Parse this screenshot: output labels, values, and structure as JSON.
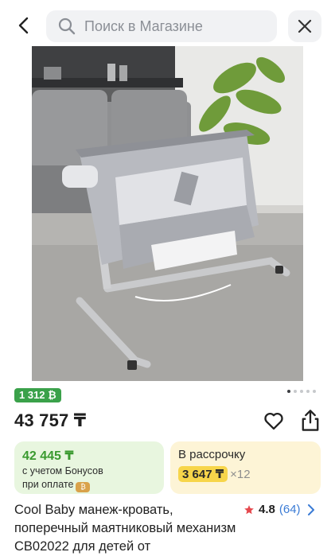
{
  "header": {
    "back_icon": "chevron-left-icon",
    "search_placeholder": "Поиск в Магазине",
    "search_icon": "search-icon",
    "close_icon": "close-icon"
  },
  "gallery": {
    "image_subject": "grey bedside baby crib on metal stand in living room",
    "dots_total": 5,
    "active_dot": 0
  },
  "product": {
    "bonus_badge": "1 312 ₿",
    "price": "43 757 ₸",
    "title": "Cool Baby манеж-кровать, поперечный маятниковый механизм CB02022 для детей от"
  },
  "bonus_card": {
    "amount": "42 445 ₸",
    "line1": "с учетом Бонусов",
    "line2": "при оплате"
  },
  "installment_card": {
    "label": "В рассрочку",
    "monthly": "3 647 ₸",
    "multiplier": "×12"
  },
  "rating": {
    "value": "4.8",
    "count": "(64)"
  },
  "colors": {
    "accent_green": "#3aa14a",
    "bonus_bg": "#e8f6df",
    "installment_bg": "#fdf4d6",
    "installment_chip": "#f7d54a",
    "link_blue": "#3a7bd5",
    "star_red": "#e5484d"
  }
}
